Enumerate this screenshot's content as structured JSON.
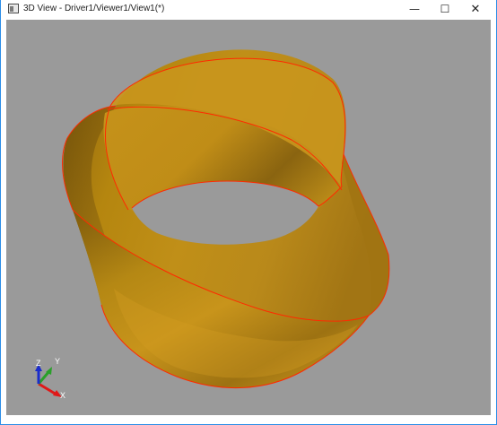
{
  "window": {
    "title": "3D View - Driver1/Viewer1/View1(*)",
    "controls": {
      "minimize": "—",
      "maximize": "☐",
      "close": "✕"
    }
  },
  "viewport": {
    "background": "#9a9a9a",
    "shape_color": "#c89018",
    "edge_color": "#ff2a00"
  },
  "axis_triad": {
    "x_label": "X",
    "y_label": "Y",
    "z_label": "Z",
    "x_color": "#e01818",
    "y_color": "#2aa02a",
    "z_color": "#1a2ccc"
  }
}
